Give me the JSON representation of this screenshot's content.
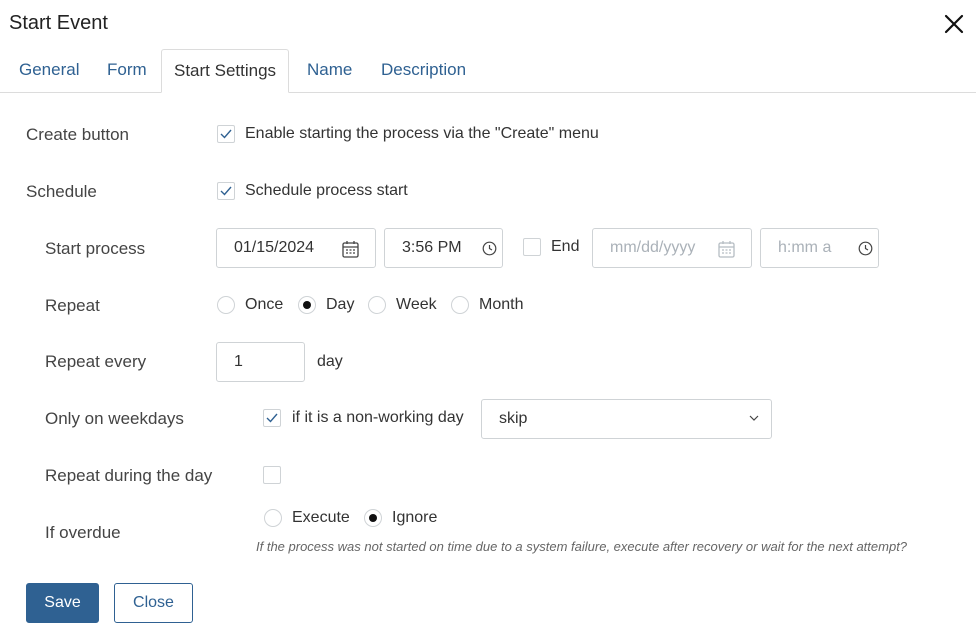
{
  "dialog": {
    "title": "Start Event"
  },
  "tabs": [
    {
      "label": "General",
      "active": false
    },
    {
      "label": "Form",
      "active": false
    },
    {
      "label": "Start Settings",
      "active": true
    },
    {
      "label": "Name",
      "active": false
    },
    {
      "label": "Description",
      "active": false
    }
  ],
  "create_button": {
    "label": "Create button",
    "checked": true,
    "option_text": "Enable starting the process via the \"Create\" menu"
  },
  "schedule": {
    "label": "Schedule",
    "checked": true,
    "option_text": "Schedule process start"
  },
  "start_process": {
    "label": "Start process",
    "date_value": "01/15/2024",
    "time_value": "3:56 PM",
    "end_checked": false,
    "end_label": "End",
    "end_date_placeholder": "mm/dd/yyyy",
    "end_time_placeholder": "h:mm a"
  },
  "repeat": {
    "label": "Repeat",
    "options": [
      "Once",
      "Day",
      "Week",
      "Month"
    ],
    "selected": "Day"
  },
  "repeat_every": {
    "label": "Repeat every",
    "value": "1",
    "unit": "day"
  },
  "weekdays": {
    "label": "Only on weekdays",
    "checked": true,
    "option_text": "if it is a non-working day",
    "select_value": "skip"
  },
  "repeat_during_day": {
    "label": "Repeat during the day",
    "checked": false
  },
  "if_overdue": {
    "label": "If overdue",
    "options": [
      "Execute",
      "Ignore"
    ],
    "selected": "Ignore",
    "hint": "If the process was not started on time due to a system failure, execute after recovery or wait for the next attempt?"
  },
  "buttons": {
    "save": "Save",
    "close": "Close"
  },
  "colors": {
    "accent": "#2f6192",
    "border": "#cfd3d6",
    "tab_line": "#dcdcdc"
  }
}
